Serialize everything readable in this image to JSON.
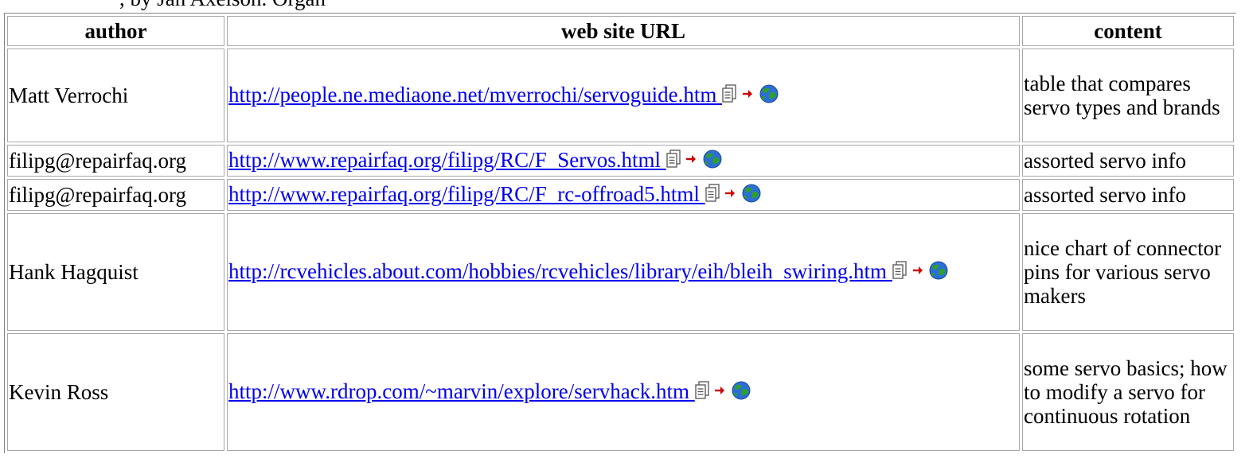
{
  "caption_fragment": ", by Jan Axelson. Organ",
  "table": {
    "headers": {
      "author": "author",
      "url": "web site URL",
      "content": "content"
    },
    "rows": [
      {
        "author": "Matt Verrochi",
        "url": "http://people.ne.mediaone.net/mverrochi/servoguide.htm ",
        "content": "table that compares servo types and brands",
        "icons": [
          "copy-page-icon",
          "red-arrow-icon",
          "globe-icon"
        ]
      },
      {
        "author": "filipg@repairfaq.org",
        "url": "http://www.repairfaq.org/filipg/RC/F_Servos.html ",
        "content": "assorted servo info",
        "icons": [
          "copy-page-icon",
          "red-arrow-icon",
          "globe-icon"
        ]
      },
      {
        "author": "filipg@repairfaq.org",
        "url": "http://www.repairfaq.org/filipg/RC/F_rc-offroad5.html ",
        "content": "assorted servo info",
        "icons": [
          "copy-page-icon",
          "red-arrow-icon",
          "globe-icon"
        ]
      },
      {
        "author": "Hank Hagquist",
        "url": "http://rcvehicles.about.com/hobbies/rcvehicles/library/eih/bleih_swiring.htm ",
        "content": "nice chart of connector pins for various servo makers",
        "icons": [
          "copy-page-icon",
          "red-arrow-icon",
          "globe-icon"
        ]
      },
      {
        "author": "Kevin Ross",
        "url": "http://www.rdrop.com/~marvin/explore/servhack.htm ",
        "content": "some servo basics; how to modify a servo for continuous rotation",
        "icons": [
          "copy-page-icon",
          "red-arrow-icon",
          "globe-icon"
        ]
      }
    ]
  },
  "colors": {
    "link": "#0000ee",
    "arrow": "#cc0000",
    "globe_ocean": "#2b6fd6",
    "globe_land": "#2e9e2e"
  }
}
